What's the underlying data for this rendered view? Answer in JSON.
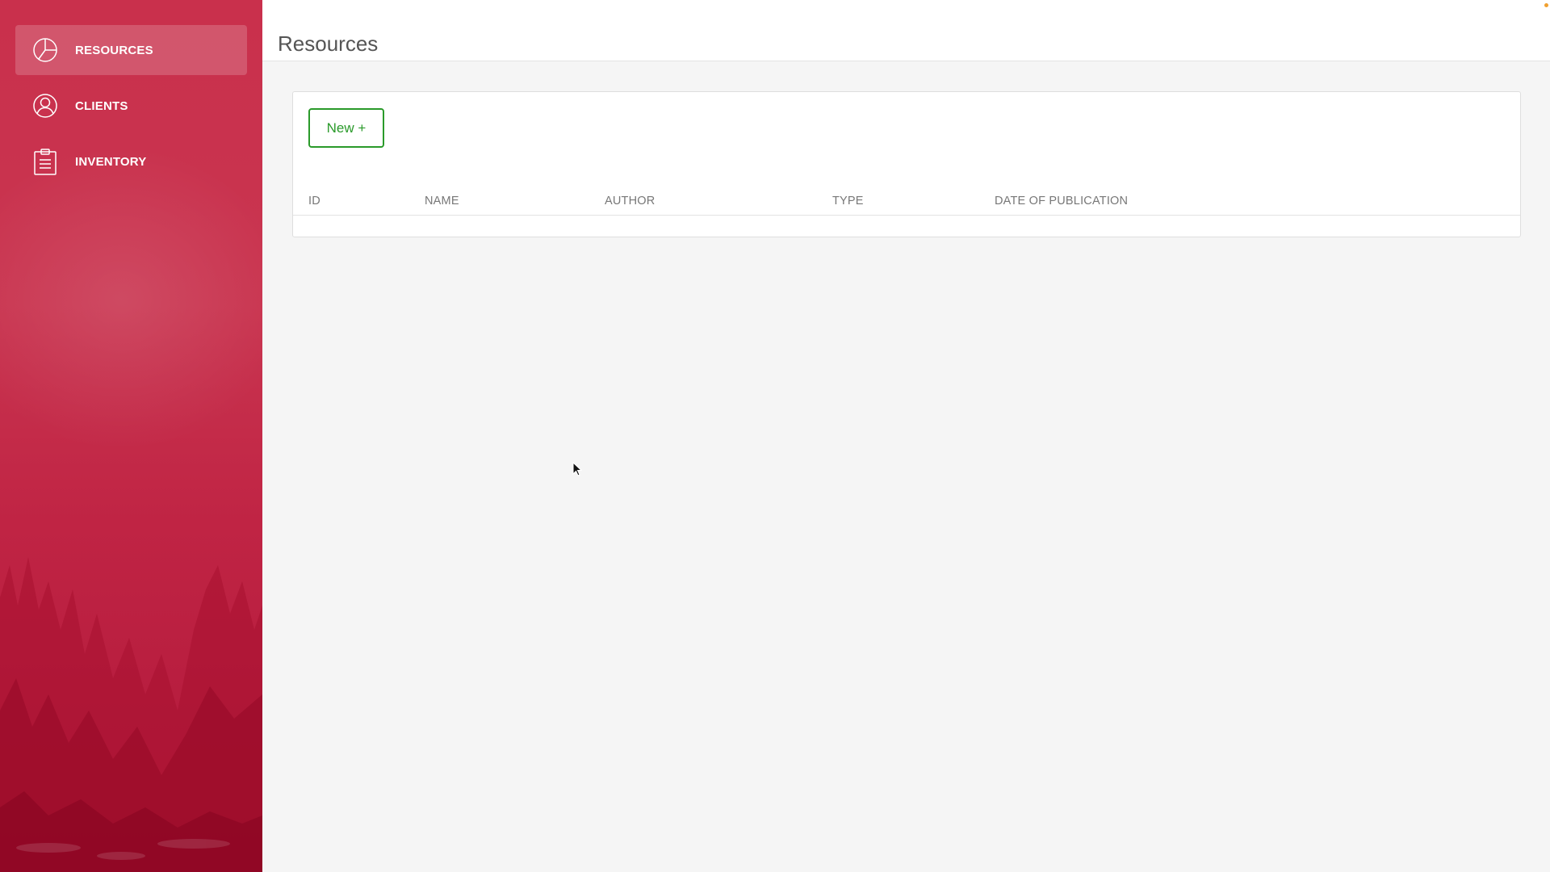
{
  "sidebar": {
    "items": [
      {
        "label": "RESOURCES",
        "icon": "pie-chart-icon",
        "active": true
      },
      {
        "label": "CLIENTS",
        "icon": "user-icon",
        "active": false
      },
      {
        "label": "INVENTORY",
        "icon": "clipboard-icon",
        "active": false
      }
    ]
  },
  "header": {
    "title": "Resources"
  },
  "main": {
    "new_button_label": "New +",
    "table": {
      "columns": [
        "ID",
        "NAME",
        "AUTHOR",
        "TYPE",
        "DATE OF PUBLICATION"
      ],
      "rows": []
    }
  },
  "colors": {
    "sidebar_accent": "#c9304c",
    "button_accent": "#2a9a2a",
    "background": "#f5f5f5"
  }
}
